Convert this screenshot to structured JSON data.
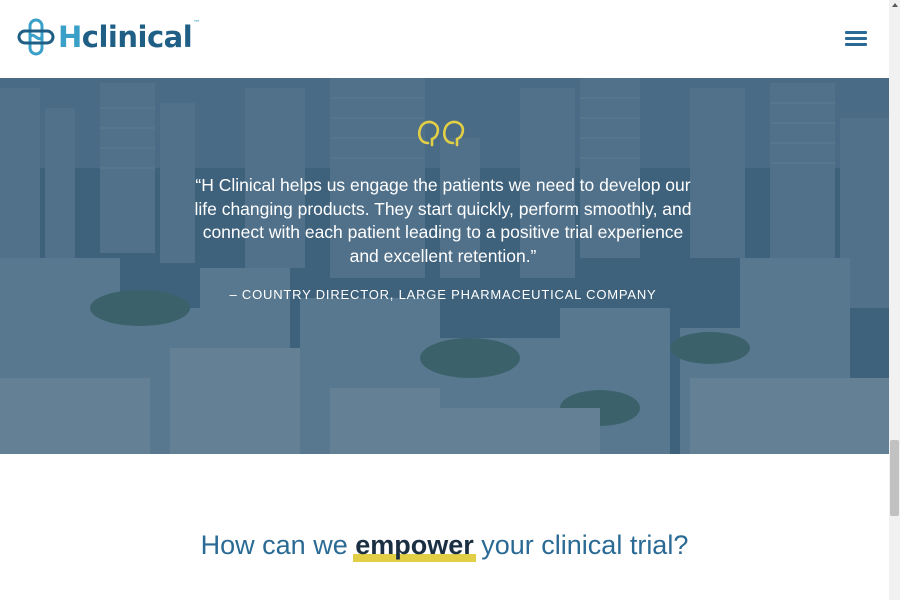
{
  "header": {
    "logo_text_h": "H",
    "logo_text_rest": "clinical",
    "logo_tm": "™",
    "menu_icon": "hamburger-menu-icon"
  },
  "testimonial": {
    "quote_icon": "double-quote-icon",
    "quote": "“H Clinical helps us engage the patients we need to develop our life changing products. They start quickly, perform smoothly, and connect with each patient leading to a positive trial experience and excellent retention.”",
    "attribution": "– COUNTRY DIRECTOR, LARGE PHARMACEUTICAL COMPANY",
    "background_image": "city-skyline-photo"
  },
  "headline": {
    "before": "How can we ",
    "emphasis": "empower",
    "after": " your clinical trial?"
  },
  "colors": {
    "brand_dark": "#1f5f86",
    "brand_light": "#3aa0c8",
    "accent_yellow": "#e2cf45",
    "hero_overlay": "#2c5270"
  }
}
